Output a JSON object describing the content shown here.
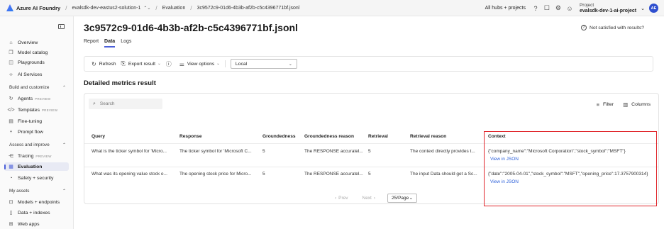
{
  "topbar": {
    "brand": "Azure AI Foundry",
    "breadcrumbs": [
      {
        "label": "evalsdk-dev-eastus2-solution-1",
        "has_chevron": true
      },
      {
        "label": "Evaluation"
      },
      {
        "label": "3c9572c9-01d6-4b3b-af2b-c5c4396771bf.jsonl"
      }
    ],
    "all_hubs": "All hubs + projects",
    "project_label": "Project",
    "project_name": "evalsdk-dev-1-ai-project",
    "avatar_initials": "AE"
  },
  "sidebar": {
    "items": [
      {
        "label": "Overview",
        "icon": "home-icon"
      },
      {
        "label": "Model catalog",
        "icon": "catalog-icon"
      },
      {
        "label": "Playgrounds",
        "icon": "playground-icon"
      },
      {
        "label": "AI Services",
        "icon": "services-icon"
      }
    ],
    "sections": [
      {
        "label": "Build and customize"
      },
      {
        "label": "Assess and improve"
      },
      {
        "label": "My assets"
      }
    ],
    "build_items": [
      {
        "label": "Agents",
        "badge": "PREVIEW"
      },
      {
        "label": "Templates",
        "badge": "PREVIEW"
      },
      {
        "label": "Fine-tuning"
      },
      {
        "label": "Prompt flow"
      }
    ],
    "assess_items": [
      {
        "label": "Tracing",
        "badge": "PREVIEW"
      },
      {
        "label": "Evaluation",
        "active": true
      },
      {
        "label": "Safety + security"
      }
    ],
    "asset_items": [
      {
        "label": "Models + endpoints"
      },
      {
        "label": "Data + indexes"
      },
      {
        "label": "Web apps"
      }
    ]
  },
  "main": {
    "title": "3c9572c9-01d6-4b3b-af2b-c5c4396771bf.jsonl",
    "not_satisfied": "Not satisfied with results?",
    "tabs": [
      {
        "label": "Report"
      },
      {
        "label": "Data",
        "active": true
      },
      {
        "label": "Logs"
      }
    ],
    "toolbar": {
      "refresh": "Refresh",
      "export": "Export result",
      "view_options": "View options",
      "source_value": "Local"
    },
    "section_title": "Detailed metrics result",
    "search_placeholder": "Search",
    "filter": "Filter",
    "columns": "Columns"
  },
  "table": {
    "headers": [
      "Query",
      "Response",
      "Groundedness",
      "Groundedness reason",
      "Retrieval",
      "Retrieval reason",
      "Context"
    ],
    "rows": [
      {
        "query": "What is the ticker symbol for 'Micro...",
        "response": "The ticker symbol for 'Microsoft C...",
        "groundedness": "5",
        "groundedness_reason": "The RESPONSE accuratel...",
        "retrieval": "5",
        "retrieval_reason": "The context directly provides t...",
        "context": "{\"company_name\":\"Microsoft Corporation\",\"stock_symbol\":\"MSFT\"}",
        "context_link": "View in JSON"
      },
      {
        "query": "What was its opening value stock o...",
        "response": "The opening stock price for Micro...",
        "groundedness": "5",
        "groundedness_reason": "The RESPONSE accuratel...",
        "retrieval": "5",
        "retrieval_reason": "The input Data should get a Sc...",
        "context": "{\"date\":\"2005-04-01\",\"stock_symbol\":\"MSFT\",\"opening_price\":17.3757900314}",
        "context_link": "View in JSON"
      }
    ]
  },
  "pager": {
    "prev": "Prev",
    "next": "Next",
    "page_size": "25/Page"
  },
  "colors": {
    "accent": "#4b5fd9",
    "highlight_border": "#e0262b",
    "link": "#2b5fd9"
  }
}
